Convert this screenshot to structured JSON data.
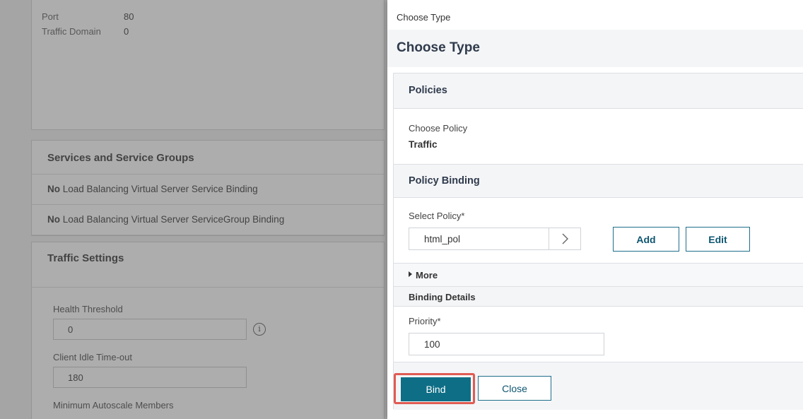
{
  "background": {
    "top_card": {
      "port_label": "Port",
      "port_value": "80",
      "td_label": "Traffic Domain",
      "td_value": "0"
    },
    "services": {
      "title": "Services and Service Groups",
      "row1_prefix": "No",
      "row1_text": "Load Balancing Virtual Server Service Binding",
      "row2_prefix": "No",
      "row2_text": "Load Balancing Virtual Server ServiceGroup Binding"
    },
    "traffic": {
      "title": "Traffic Settings",
      "health_label": "Health Threshold",
      "health_value": "0",
      "idle_label": "Client Idle Time-out",
      "idle_value": "180",
      "autoscale_label": "Minimum Autoscale Members",
      "info_icon_glyph": "i"
    }
  },
  "dialog": {
    "breadcrumb": "Choose Type",
    "title": "Choose Type",
    "policies": {
      "header": "Policies",
      "choose_policy_label": "Choose Policy",
      "choose_policy_value": "Traffic"
    },
    "policy_binding": {
      "header": "Policy Binding",
      "select_policy_label": "Select Policy*",
      "select_policy_value": "html_pol",
      "add_label": "Add",
      "edit_label": "Edit",
      "more_label": "More"
    },
    "binding_details": {
      "header": "Binding Details",
      "priority_label": "Priority*",
      "priority_value": "100"
    },
    "footer": {
      "bind_label": "Bind",
      "close_label": "Close"
    }
  },
  "colors": {
    "primary": "#0e6e86",
    "outline": "#1f6f8b",
    "highlight": "#e05b53"
  }
}
